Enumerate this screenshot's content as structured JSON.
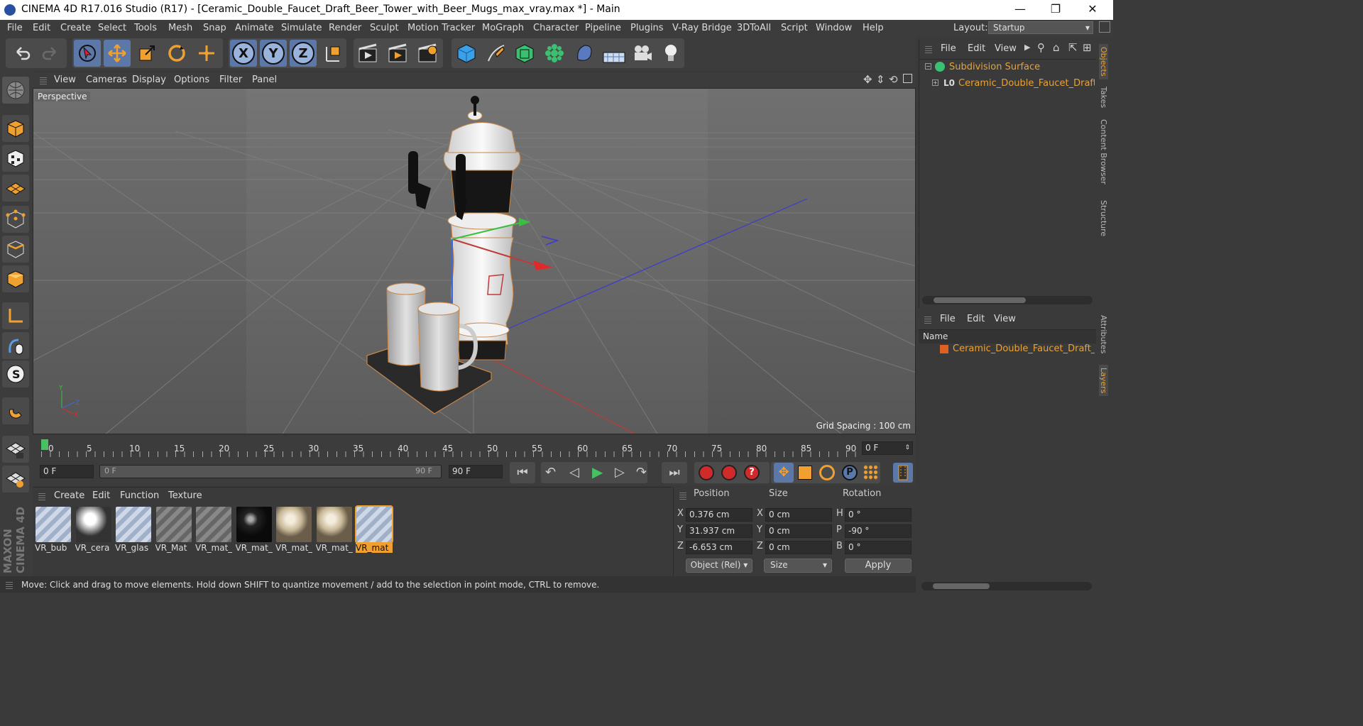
{
  "window": {
    "title": "CINEMA 4D R17.016 Studio (R17) - [Ceramic_Double_Faucet_Draft_Beer_Tower_with_Beer_Mugs_max_vray.max *] - Main",
    "minimize": "—",
    "restore": "❐",
    "close": "✕"
  },
  "menubar": [
    "File",
    "Edit",
    "Create",
    "Select",
    "Tools",
    "Mesh",
    "Snap",
    "Animate",
    "Simulate",
    "Render",
    "Sculpt",
    "Motion Tracker",
    "MoGraph",
    "Character",
    "Pipeline",
    "Plugins",
    "V-Ray Bridge",
    "3DToAll",
    "Script",
    "Window",
    "Help"
  ],
  "layout": {
    "label": "Layout:",
    "value": "Startup"
  },
  "toolbar": {
    "x": "X",
    "y": "Y",
    "z": "Z"
  },
  "viewport": {
    "menu": [
      "View",
      "Cameras",
      "Display",
      "Options",
      "Filter",
      "Panel"
    ],
    "label": "Perspective",
    "grid_spacing": "Grid Spacing : 100 cm"
  },
  "timeline": {
    "ticks": [
      "0",
      "5",
      "10",
      "15",
      "20",
      "25",
      "30",
      "35",
      "40",
      "45",
      "50",
      "55",
      "60",
      "65",
      "70",
      "75",
      "80",
      "85",
      "90"
    ],
    "current_frame": "0 F",
    "start_field": "0 F",
    "range_start": "0 F",
    "range_end": "90 F",
    "end_field": "90 F"
  },
  "materials": {
    "menu": [
      "Create",
      "Edit",
      "Function",
      "Texture"
    ],
    "items": [
      {
        "label": "VR_bub",
        "kind": "glass"
      },
      {
        "label": "VR_cera",
        "kind": "ceramic"
      },
      {
        "label": "VR_glas",
        "kind": "glass"
      },
      {
        "label": "VR_Mat",
        "kind": "stripes"
      },
      {
        "label": "VR_mat_",
        "kind": "stripes"
      },
      {
        "label": "VR_mat_",
        "kind": "black"
      },
      {
        "label": "VR_mat_",
        "kind": "beige"
      },
      {
        "label": "VR_mat_",
        "kind": "beige"
      },
      {
        "label": "VR_mat",
        "kind": "glass",
        "selected": true
      }
    ]
  },
  "coords": {
    "headers": {
      "position": "Position",
      "size": "Size",
      "rotation": "Rotation"
    },
    "rows": [
      {
        "axis": "X",
        "pos": "0.376 cm",
        "saxis": "X",
        "size": "0 cm",
        "raxis": "H",
        "rot": "0 °"
      },
      {
        "axis": "Y",
        "pos": "31.937 cm",
        "saxis": "Y",
        "size": "0 cm",
        "raxis": "P",
        "rot": "-90 °"
      },
      {
        "axis": "Z",
        "pos": "-6.653 cm",
        "saxis": "Z",
        "size": "0 cm",
        "raxis": "B",
        "rot": "0 °"
      }
    ],
    "mode": "Object (Rel)",
    "size_mode": "Size",
    "apply": "Apply"
  },
  "status": "Move: Click and drag to move elements. Hold down SHIFT to quantize movement / add to the selection in point mode, CTRL to remove.",
  "objects": {
    "menu": [
      "File",
      "Edit",
      "View"
    ],
    "items": [
      {
        "label": "Subdivision Surface"
      },
      {
        "label": "Ceramic_Double_Faucet_Draft_Be"
      }
    ]
  },
  "layers": {
    "menu": [
      "File",
      "Edit",
      "View"
    ],
    "header": "Name",
    "items": [
      {
        "label": "Ceramic_Double_Faucet_Draft_Bee"
      }
    ]
  },
  "side_tabs": [
    "Objects",
    "Takes",
    "Content Browser",
    "Structure",
    "Attributes",
    "Layers"
  ],
  "colors": {
    "accent": "#f0a030",
    "selection": "#5b78a8",
    "viewport_bg": "#5a5a5a"
  }
}
